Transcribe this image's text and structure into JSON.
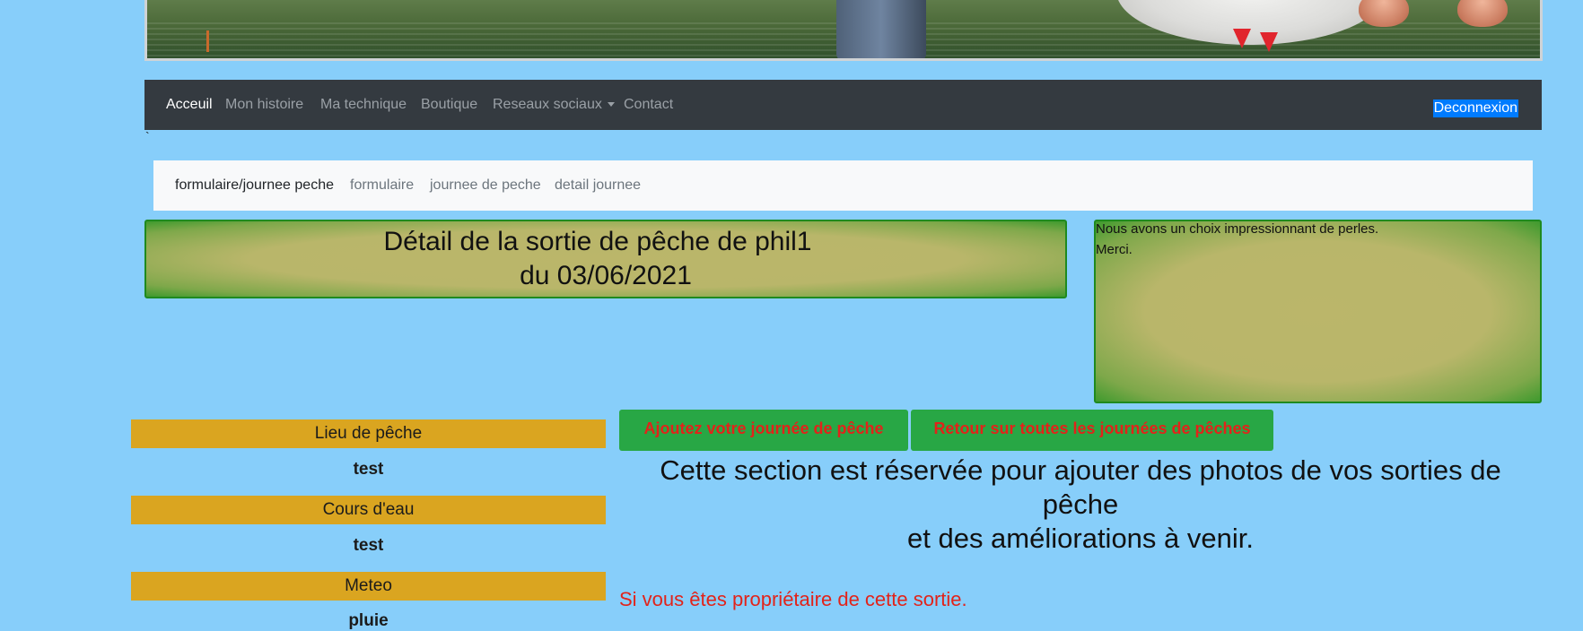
{
  "nav": {
    "items": [
      {
        "label": "Acceuil"
      },
      {
        "label": "Mon histoire"
      },
      {
        "label": "Ma technique"
      },
      {
        "label": "Boutique"
      },
      {
        "label": "Reseaux sociaux"
      },
      {
        "label": "Contact"
      }
    ],
    "logout_label": "Deconnexion"
  },
  "stray_char": "`",
  "breadcrumb": {
    "items": [
      {
        "label": "formulaire/journee peche"
      },
      {
        "label": "formulaire"
      },
      {
        "label": "journee de peche"
      },
      {
        "label": "detail journee"
      }
    ]
  },
  "title_panel": {
    "line1": "Détail de la sortie de pêche de   phil1",
    "line2": "du   03/06/2021"
  },
  "info_panel": {
    "line1": "Nous avons un choix impressionnant de perles.",
    "line2": "Merci."
  },
  "fields": [
    {
      "label": "Lieu de pêche",
      "value": "test"
    },
    {
      "label": "Cours d'eau",
      "value": "test"
    },
    {
      "label": "Meteo",
      "value": "pluie"
    }
  ],
  "buttons": {
    "add": "Ajoutez votre journée de pêche",
    "back": "Retour sur toutes les journées de pêches"
  },
  "section": {
    "line1": "Cette section est réservée pour ajouter des photos de vos sorties de",
    "line2": "pêche",
    "line3": "et des améliorations à venir."
  },
  "owner_note": "Si vous êtes propriétaire de cette sortie.",
  "colors": {
    "page_background": "#87cefa",
    "navbar": "#343a40",
    "field_label": "#daa520",
    "button": "#28a745",
    "button_text": "#e2231a"
  }
}
